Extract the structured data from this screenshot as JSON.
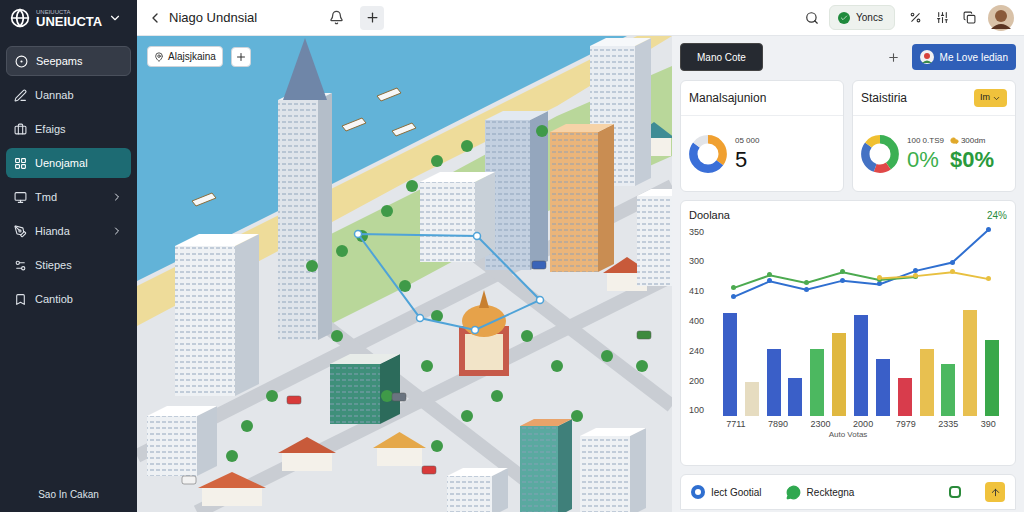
{
  "sidebar": {
    "brand_caption": "UNEIUUCTA",
    "brand": "UNEIUCTA",
    "items": [
      {
        "label": "Seepams",
        "selected": false,
        "highlighted": true,
        "expandable": false
      },
      {
        "label": "Uannab",
        "selected": false,
        "highlighted": false,
        "expandable": false
      },
      {
        "label": "Efaigs",
        "selected": false,
        "highlighted": false,
        "expandable": false
      },
      {
        "label": "Uenojamal",
        "selected": true,
        "highlighted": false,
        "expandable": false
      },
      {
        "label": "Tmd",
        "selected": false,
        "highlighted": false,
        "expandable": true
      },
      {
        "label": "Hianda",
        "selected": false,
        "highlighted": false,
        "expandable": true
      },
      {
        "label": "Stiepes",
        "selected": false,
        "highlighted": false,
        "expandable": false
      },
      {
        "label": "Cantiob",
        "selected": false,
        "highlighted": false,
        "expandable": false
      }
    ],
    "footer": "Sao In Cakan"
  },
  "topbar": {
    "title": "Niago Undnsial",
    "pill": "Yoncs"
  },
  "map": {
    "label": "Alajsjkaina"
  },
  "toolbar": {
    "dark_button": "Mano Cote",
    "primary_button": "Me Love Iedian"
  },
  "cards": [
    {
      "title": "Manalsajunion",
      "donut": [
        {
          "value": 35,
          "color": "#f0a030"
        },
        {
          "value": 50,
          "color": "#3a6fd8"
        },
        {
          "value": 15,
          "color": "#e2e4e8"
        }
      ],
      "stats": [
        {
          "caption": "05 000",
          "value": "5"
        }
      ]
    },
    {
      "title": "Staistiria",
      "badge": "Im",
      "donut": [
        {
          "value": 40,
          "color": "#3cb054"
        },
        {
          "value": 15,
          "color": "#e04848"
        },
        {
          "value": 30,
          "color": "#4472c4"
        },
        {
          "value": 15,
          "color": "#f0c030"
        }
      ],
      "stats": [
        {
          "caption": "100 0.TS9",
          "value": "0%"
        },
        {
          "caption": "300dm",
          "value": "$0%"
        }
      ]
    }
  ],
  "chart": {
    "title": "Doolana",
    "change": "24%",
    "min": 100,
    "max": 350,
    "y_ticks": [
      "350",
      "300",
      "410",
      "400",
      "240",
      "200",
      "100"
    ],
    "x_labels": [
      "7711",
      "7890",
      "2300",
      "2000",
      "7979",
      "2335",
      "390"
    ],
    "x_caption": "Auto Votas",
    "bars": [
      {
        "value": 236,
        "color": "#3a5fc8"
      },
      {
        "value": 144,
        "color": "#e6dcc0"
      },
      {
        "value": 188,
        "color": "#3a5fc8"
      },
      {
        "value": 150,
        "color": "#3a5fc8"
      },
      {
        "value": 188,
        "color": "#4cb860"
      },
      {
        "value": 210,
        "color": "#e0b840"
      },
      {
        "value": 233,
        "color": "#3a5fc8"
      },
      {
        "value": 175,
        "color": "#3a5fc8"
      },
      {
        "value": 150,
        "color": "#d83c4c"
      },
      {
        "value": 188,
        "color": "#e8c050"
      },
      {
        "value": 169,
        "color": "#4cb860"
      },
      {
        "value": 240,
        "color": "#e8c050"
      },
      {
        "value": 200,
        "color": "#3aa84a"
      }
    ],
    "lines": [
      {
        "color": "#2f6fd0",
        "values": [
          258,
          279,
          268,
          280,
          275,
          293,
          304,
          348
        ]
      },
      {
        "color": "#4caa50",
        "values": [
          270,
          287,
          277,
          291,
          281,
          285,
          null,
          null
        ]
      },
      {
        "color": "#e8c040",
        "values": [
          null,
          null,
          null,
          null,
          283,
          286,
          291,
          282
        ]
      }
    ]
  },
  "bottom_bar": {
    "items": [
      {
        "label": "Iect Gootial",
        "color": "#2f6fd0"
      },
      {
        "label": "Recktegna",
        "color": "#2fa84f"
      }
    ]
  }
}
